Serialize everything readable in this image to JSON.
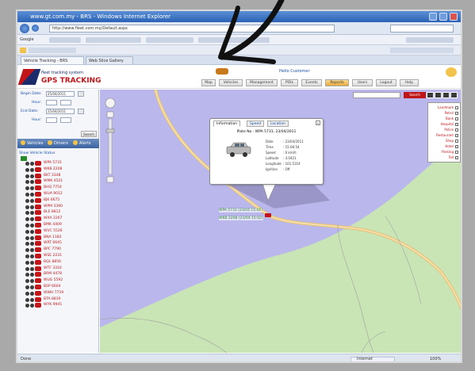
{
  "browser": {
    "title": "www.gt.com.my - BRS - Windows Internet Explorer",
    "url": "http://www.fleet.com.my/Default.aspx",
    "search_engine": "Google",
    "tabs": [
      {
        "label": "Vehicle Tracking - BRS"
      },
      {
        "label": "Web Slice Gallery"
      }
    ],
    "statusbar": {
      "left": "Done",
      "zone": "Internet",
      "zoom": "100%"
    }
  },
  "app": {
    "logo_line1": "fleet tracking system",
    "logo_line2": "GPS TRACKING",
    "user_link": "Hello Customer",
    "nav": [
      "Map",
      "Vehicles",
      "Management",
      "POIs",
      "Events",
      "Reports",
      "Users",
      "Logout",
      "Help"
    ]
  },
  "sidebar": {
    "form": {
      "begin_date_label": "Begin Date:",
      "begin_date_value": "25/04/2011",
      "hour_label": "Hour:",
      "end_date_label": "End Date:",
      "end_date_value": "25/04/2011",
      "hour2_label": "Hour:",
      "search_label": "Search"
    },
    "tabs": [
      "Vehicles",
      "Drivers",
      "Alerts"
    ],
    "tree_header": "Show Vehicle Status",
    "vehicles": [
      "WPA 5731",
      "WKB 2208",
      "BKT 3348",
      "WMK 4521",
      "BHQ 7754",
      "WUA 9012",
      "BJK 6675",
      "WPM 3390",
      "BLE 8812",
      "WXA 2267",
      "BMK 4409",
      "WVC 5526",
      "BNA 1183",
      "WRT 6645",
      "BPC 7790",
      "WSE 2231",
      "BQL 8856",
      "WTF 3310",
      "BRM 4478",
      "WUG 5592",
      "BSP 6604",
      "WWH 7719",
      "BTA 8830",
      "WYK 9945"
    ]
  },
  "map": {
    "search_button": "Search",
    "layers": [
      "Landmark",
      "Petrol",
      "Bank",
      "Hospital",
      "Police",
      "Restaurant",
      "Shop",
      "Hotel",
      "Parking",
      "Toll"
    ],
    "popup": {
      "tabs": [
        "Information",
        "Speed",
        "Location"
      ],
      "title": "Plate No : WPA 5731, 23/04/2011",
      "rows": [
        {
          "k": "Date",
          "v": ": 23/04/2011"
        },
        {
          "k": "Time",
          "v": ": 15:06:54"
        },
        {
          "k": "Speed",
          "v": ": 0 km/h"
        },
        {
          "k": "Latitude",
          "v": ": 3.0421"
        },
        {
          "k": "Longitude",
          "v": ": 101.5314"
        },
        {
          "k": "Ignition",
          "v": ": Off"
        }
      ]
    },
    "vehicle_labels": [
      "WPA 5731 (23/04 15:06)",
      "WKB 2208 (23/04 15:02)"
    ]
  },
  "colors": {
    "brand_red": "#c0161a",
    "brand_blue": "#1b2b6b",
    "map_water": "#bab7ec",
    "map_land": "#c9e5b6",
    "road": "#e8c37a"
  }
}
